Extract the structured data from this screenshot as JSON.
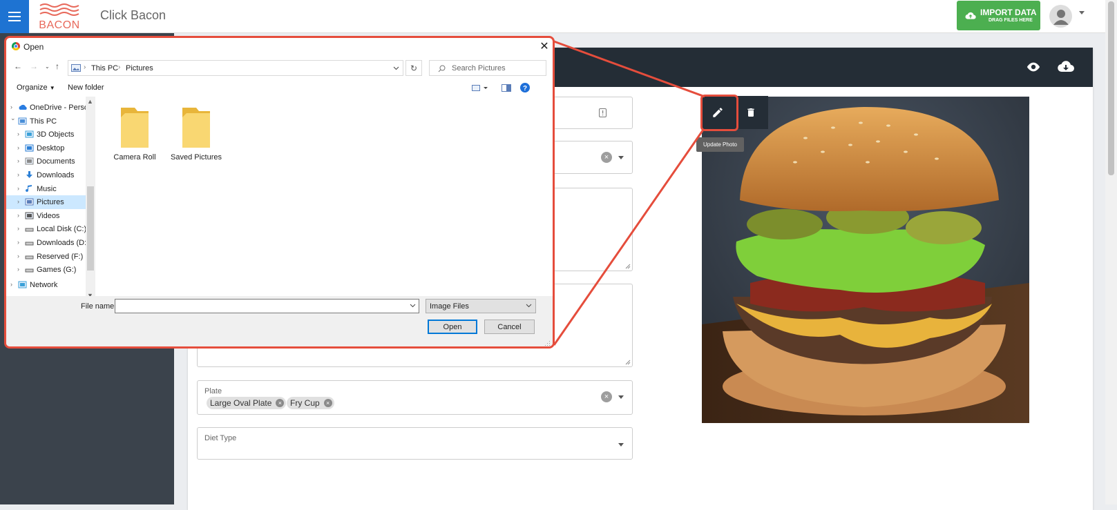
{
  "app": {
    "title": "Click Bacon",
    "logo_text": "BACON",
    "import": {
      "label": "IMPORT DATA",
      "sublabel": "DRAG FILES HERE"
    }
  },
  "form": {
    "plate": {
      "label": "Plate",
      "chips": [
        "Large Oval Plate",
        "Fry Cup"
      ]
    },
    "diet": {
      "label": "Diet Type"
    }
  },
  "photo": {
    "tooltip": "Update Photo",
    "edit_icon": "pencil-icon",
    "delete_icon": "trash-icon"
  },
  "dialog": {
    "title": "Open",
    "path": [
      "This PC",
      "Pictures"
    ],
    "search_placeholder": "Search Pictures",
    "toolbar": {
      "organize": "Organize",
      "new_folder": "New folder"
    },
    "tree": [
      {
        "label": "OneDrive - Personal",
        "icon": "onedrive-icon",
        "indent": 0
      },
      {
        "label": "This PC",
        "icon": "pc-icon",
        "indent": 0,
        "expanded": true
      },
      {
        "label": "3D Objects",
        "icon": "3d-objects-icon",
        "indent": 1
      },
      {
        "label": "Desktop",
        "icon": "desktop-icon",
        "indent": 1
      },
      {
        "label": "Documents",
        "icon": "documents-icon",
        "indent": 1
      },
      {
        "label": "Downloads",
        "icon": "downloads-icon",
        "indent": 1
      },
      {
        "label": "Music",
        "icon": "music-icon",
        "indent": 1
      },
      {
        "label": "Pictures",
        "icon": "pictures-icon",
        "indent": 1,
        "selected": true
      },
      {
        "label": "Videos",
        "icon": "videos-icon",
        "indent": 1
      },
      {
        "label": "Local Disk (C:)",
        "icon": "drive-icon",
        "indent": 1
      },
      {
        "label": "Downloads (D:)",
        "icon": "drive-icon",
        "indent": 1
      },
      {
        "label": "Reserved (F:)",
        "icon": "drive-icon",
        "indent": 1
      },
      {
        "label": "Games (G:)",
        "icon": "drive-icon",
        "indent": 1
      },
      {
        "label": "Network",
        "icon": "network-icon",
        "indent": 0
      }
    ],
    "folders": [
      "Camera Roll",
      "Saved Pictures"
    ],
    "file_name": {
      "label": "File name:",
      "value": ""
    },
    "file_type": "Image Files",
    "open_label": "Open",
    "cancel_label": "Cancel"
  },
  "colors": {
    "accent": "#1e73d2",
    "import_green": "#4caf50",
    "sidebar": "#3b434c",
    "card_header": "#242d36",
    "highlight": "#e54d3c"
  }
}
